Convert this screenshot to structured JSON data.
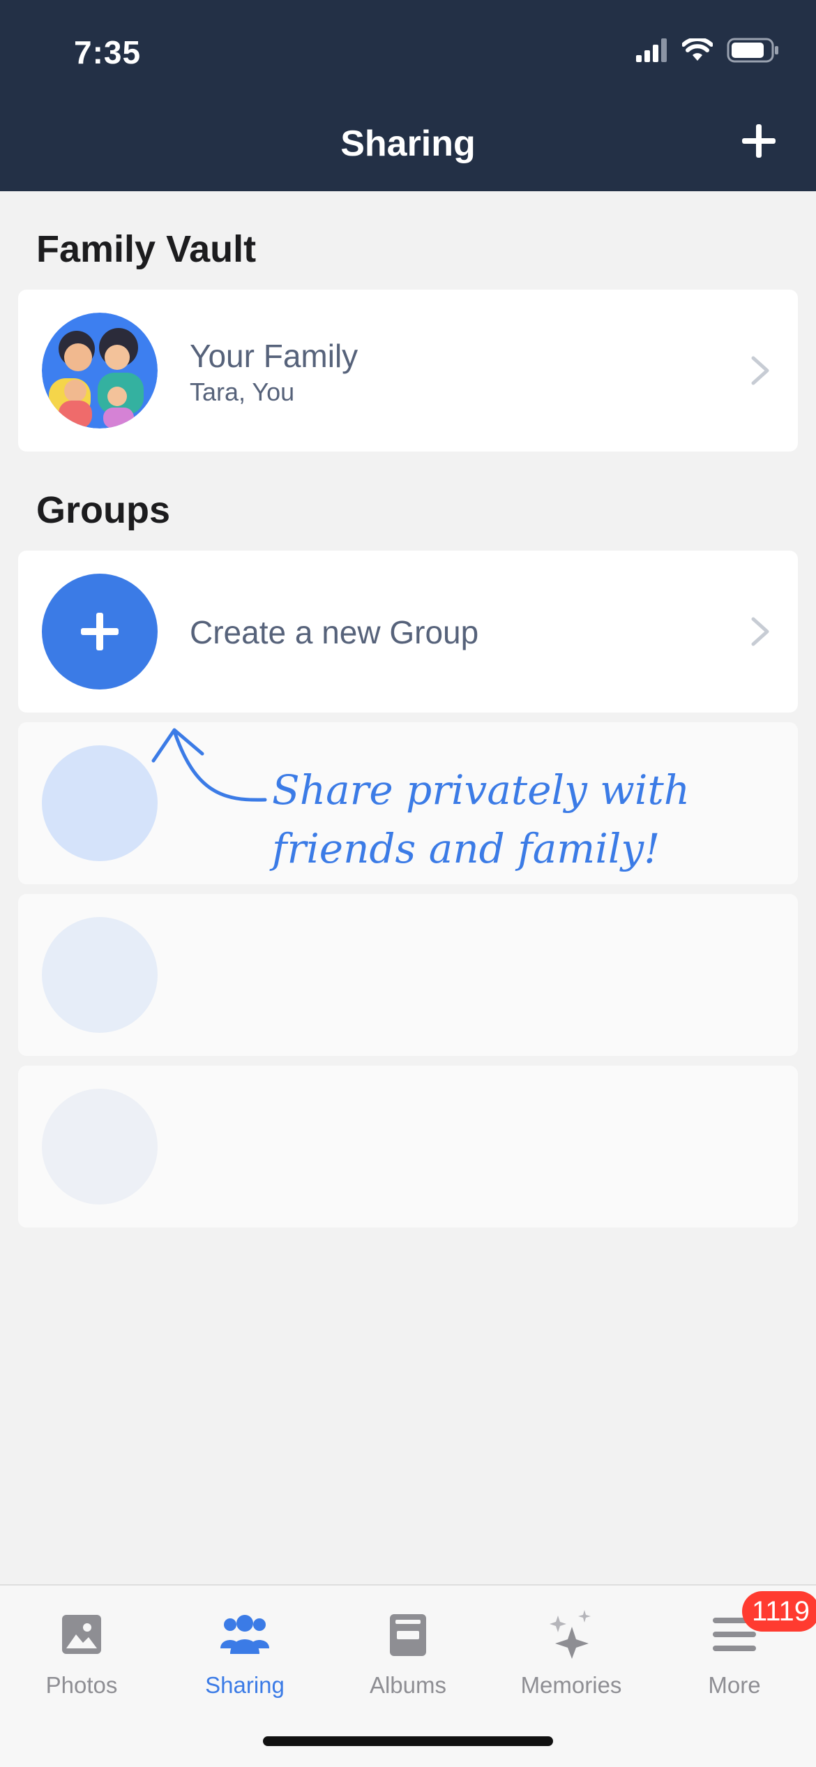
{
  "status_bar": {
    "time": "7:35"
  },
  "header": {
    "title": "Sharing"
  },
  "family_vault": {
    "section_title": "Family Vault",
    "card": {
      "title": "Your Family",
      "subtitle": "Tara, You"
    }
  },
  "groups": {
    "section_title": "Groups",
    "create_label": "Create a new Group",
    "hint_text": "Share privately with friends and family!"
  },
  "tabs": [
    {
      "label": "Photos",
      "icon": "photo-icon",
      "active": false
    },
    {
      "label": "Sharing",
      "icon": "people-icon",
      "active": true
    },
    {
      "label": "Albums",
      "icon": "album-icon",
      "active": false
    },
    {
      "label": "Memories",
      "icon": "sparkle-icon",
      "active": false
    },
    {
      "label": "More",
      "icon": "menu-icon",
      "active": false,
      "badge": "1119"
    }
  ],
  "colors": {
    "header_bg": "#233046",
    "accent": "#3b7be6",
    "badge": "#ff3b30"
  }
}
